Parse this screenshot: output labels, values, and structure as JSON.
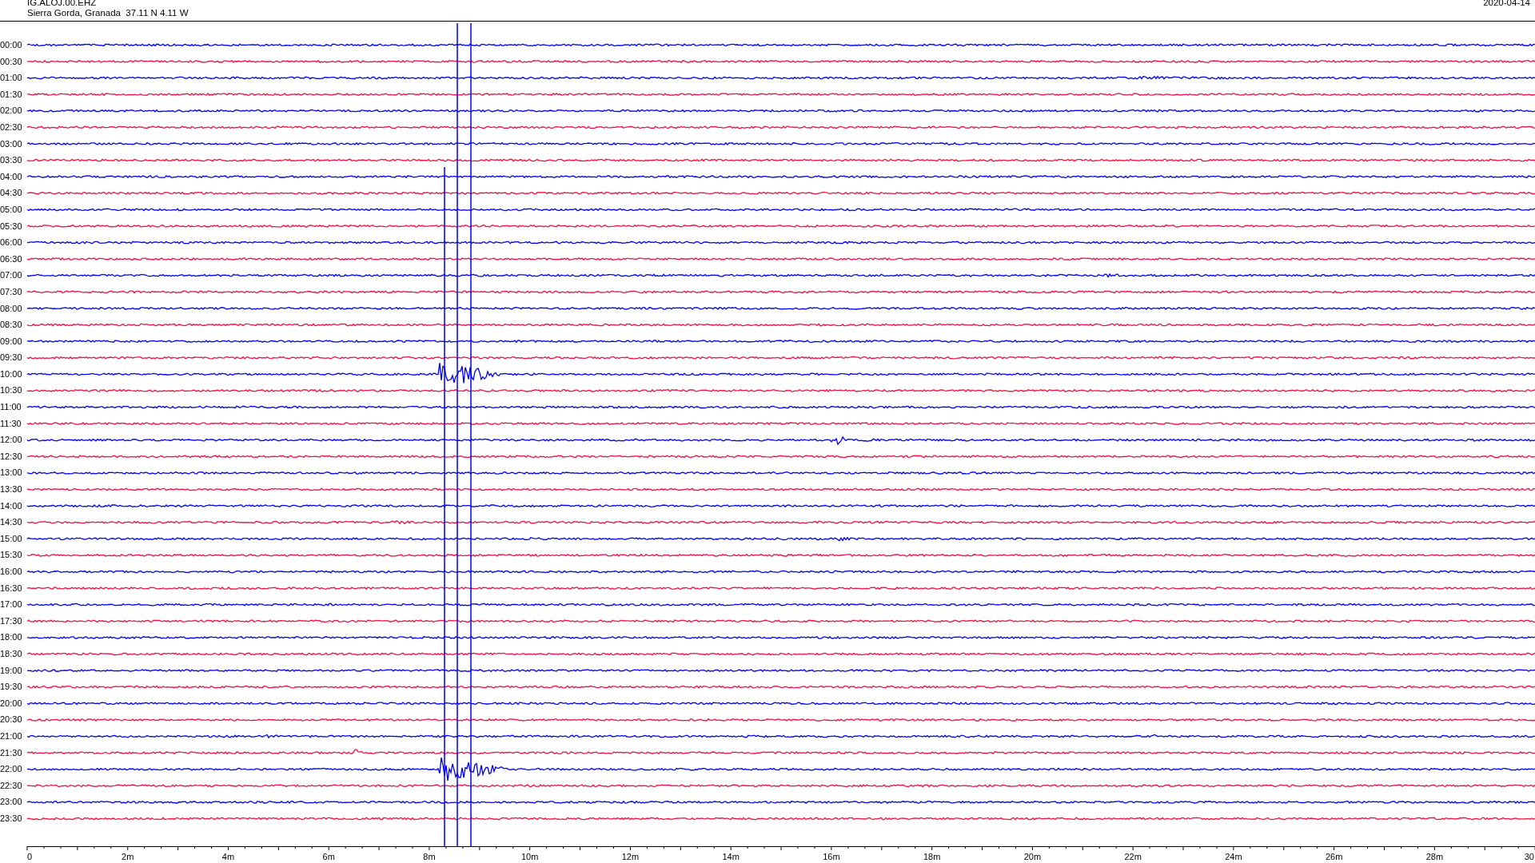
{
  "header": {
    "station": "IG.ALOJ.00.EHZ",
    "location": "Sierra Gorda, Granada  37.11 N 4.11 W",
    "date": "2020-04-14"
  },
  "rows": [
    {
      "time": "00:00",
      "color": "#0000ee"
    },
    {
      "time": "00:30",
      "color": "#ee1144"
    },
    {
      "time": "01:00",
      "color": "#0000ee"
    },
    {
      "time": "01:30",
      "color": "#ee1144"
    },
    {
      "time": "02:00",
      "color": "#0000ee"
    },
    {
      "time": "02:30",
      "color": "#ee1144"
    },
    {
      "time": "03:00",
      "color": "#0000ee"
    },
    {
      "time": "03:30",
      "color": "#ee1144"
    },
    {
      "time": "04:00",
      "color": "#0000ee"
    },
    {
      "time": "04:30",
      "color": "#ee1144"
    },
    {
      "time": "05:00",
      "color": "#0000ee"
    },
    {
      "time": "05:30",
      "color": "#ee1144"
    },
    {
      "time": "06:00",
      "color": "#0000ee"
    },
    {
      "time": "06:30",
      "color": "#ee1144"
    },
    {
      "time": "07:00",
      "color": "#0000ee"
    },
    {
      "time": "07:30",
      "color": "#ee1144"
    },
    {
      "time": "08:00",
      "color": "#0000ee"
    },
    {
      "time": "08:30",
      "color": "#ee1144"
    },
    {
      "time": "09:00",
      "color": "#0000ee"
    },
    {
      "time": "09:30",
      "color": "#ee1144"
    },
    {
      "time": "10:00",
      "color": "#0000ee"
    },
    {
      "time": "10:30",
      "color": "#ee1144"
    },
    {
      "time": "11:00",
      "color": "#0000ee"
    },
    {
      "time": "11:30",
      "color": "#ee1144"
    },
    {
      "time": "12:00",
      "color": "#0000ee"
    },
    {
      "time": "12:30",
      "color": "#ee1144"
    },
    {
      "time": "13:00",
      "color": "#0000ee"
    },
    {
      "time": "13:30",
      "color": "#ee1144"
    },
    {
      "time": "14:00",
      "color": "#0000ee"
    },
    {
      "time": "14:30",
      "color": "#ee1144"
    },
    {
      "time": "15:00",
      "color": "#0000ee"
    },
    {
      "time": "15:30",
      "color": "#ee1144"
    },
    {
      "time": "16:00",
      "color": "#0000ee"
    },
    {
      "time": "16:30",
      "color": "#ee1144"
    },
    {
      "time": "17:00",
      "color": "#0000ee"
    },
    {
      "time": "17:30",
      "color": "#ee1144"
    },
    {
      "time": "18:00",
      "color": "#0000ee"
    },
    {
      "time": "18:30",
      "color": "#ee1144"
    },
    {
      "time": "19:00",
      "color": "#0000ee"
    },
    {
      "time": "19:30",
      "color": "#ee1144"
    },
    {
      "time": "20:00",
      "color": "#0000ee"
    },
    {
      "time": "20:30",
      "color": "#ee1144"
    },
    {
      "time": "21:00",
      "color": "#0000ee"
    },
    {
      "time": "21:30",
      "color": "#ee1144"
    },
    {
      "time": "22:00",
      "color": "#0000ee"
    },
    {
      "time": "22:30",
      "color": "#ee1144"
    },
    {
      "time": "23:00",
      "color": "#0000ee"
    },
    {
      "time": "23:30",
      "color": "#ee1144"
    }
  ],
  "x_axis": {
    "ticks": [
      "0",
      "2m",
      "4m",
      "6m",
      "8m",
      "10m",
      "12m",
      "14m",
      "16m",
      "18m",
      "20m",
      "22m",
      "24m",
      "26m",
      "28m",
      "30"
    ]
  }
}
